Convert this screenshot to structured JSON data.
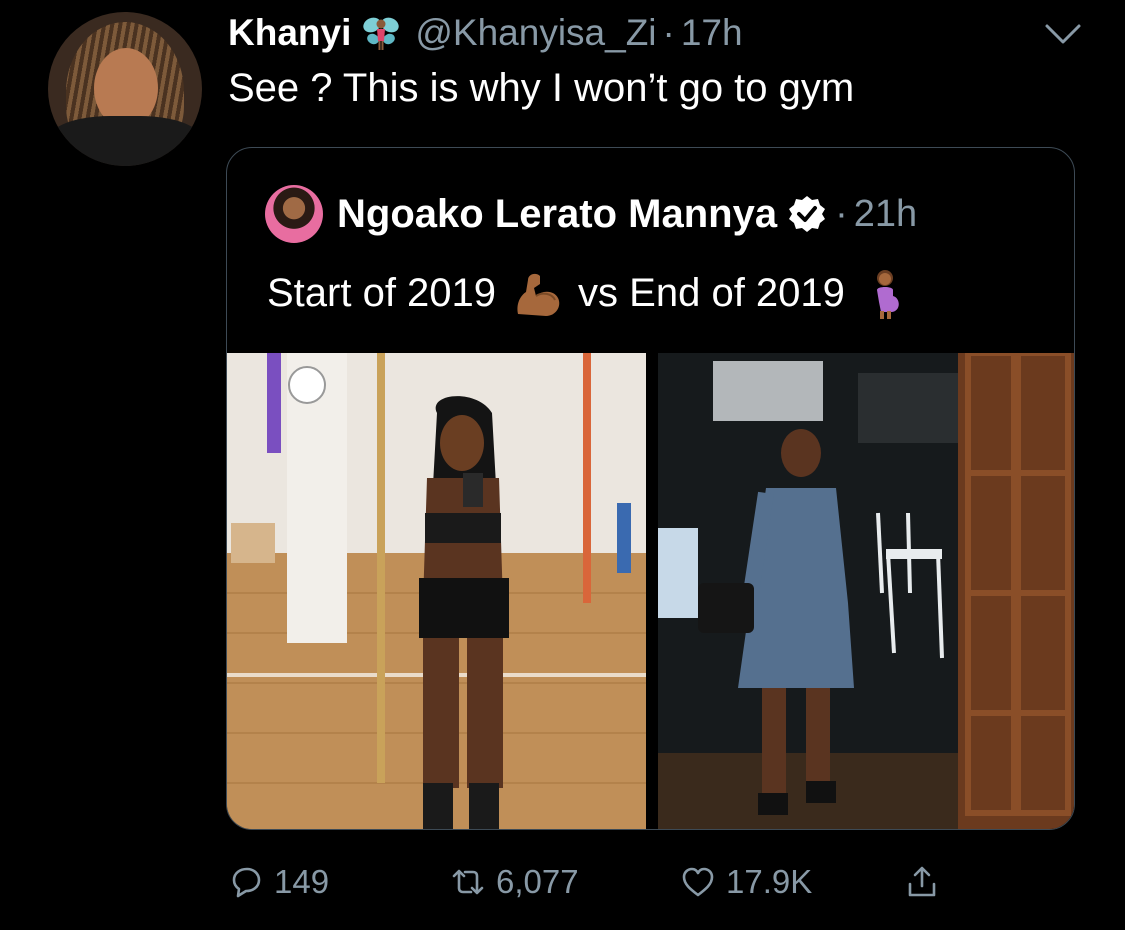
{
  "tweet": {
    "author_name": "Khanyi",
    "author_handle": "@Khanyisa_Zi",
    "separator": "·",
    "time": "17h",
    "text": "See ? This is why I won’t go to gym",
    "name_emoji": "fairy-emoji",
    "menu_icon": "chevron-down-icon"
  },
  "quoted_tweet": {
    "author_name": "Ngoako Lerato Mannya",
    "verified": true,
    "separator": "·",
    "time": "21h",
    "text_part1": "Start of 2019",
    "emoji1": "flexed-biceps-emoji",
    "text_part2": "vs End of 2019",
    "emoji2": "pregnant-woman-emoji",
    "photos": [
      "gym-mirror-selfie-photo",
      "restaurant-pregnant-woman-photo"
    ]
  },
  "actions": {
    "reply_count": "149",
    "retweet_count": "6,077",
    "like_count": "17.9K",
    "icons": [
      "reply-icon",
      "retweet-icon",
      "like-icon",
      "share-icon"
    ]
  },
  "colors": {
    "background": "#000000",
    "text_primary": "#ffffff",
    "text_secondary": "#8899a6",
    "border": "#3d4a55",
    "verified_badge": "#ffffff"
  }
}
